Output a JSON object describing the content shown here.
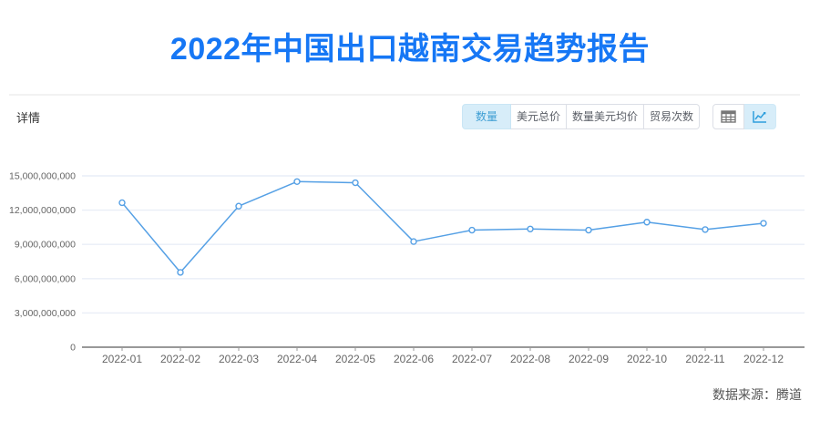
{
  "page": {
    "title": "2022年中国出口越南交易趋势报告",
    "section_label": "详情",
    "source_note": "数据来源：腾道"
  },
  "toolbar": {
    "metric_tabs": [
      {
        "label": "数量",
        "selected": true
      },
      {
        "label": "美元总价",
        "selected": false
      },
      {
        "label": "数量美元均价",
        "selected": false
      },
      {
        "label": "贸易次数",
        "selected": false
      }
    ],
    "view_toggles": [
      {
        "icon": "table-icon",
        "selected": false
      },
      {
        "icon": "line-chart-icon",
        "selected": true
      }
    ]
  },
  "colors": {
    "title_blue": "#1677f5",
    "line_blue": "#55a0e5",
    "selected_bg": "#d7edf9",
    "selected_text": "#3f9fd4",
    "grid_line": "#e9eef7",
    "axis_line": "#999999",
    "tick_label": "#666666"
  },
  "chart_data": {
    "type": "line",
    "title": "",
    "xlabel": "",
    "ylabel": "",
    "x": [
      "2022-01",
      "2022-02",
      "2022-03",
      "2022-04",
      "2022-05",
      "2022-06",
      "2022-07",
      "2022-08",
      "2022-09",
      "2022-10",
      "2022-11",
      "2022-12"
    ],
    "series": [
      {
        "name": "数量",
        "values": [
          12650000000,
          6550000000,
          12350000000,
          14500000000,
          14400000000,
          9250000000,
          10250000000,
          10350000000,
          10250000000,
          10950000000,
          10300000000,
          10850000000
        ]
      }
    ],
    "ylim": [
      0,
      15000000000
    ],
    "yticks": [
      0,
      3000000000,
      6000000000,
      9000000000,
      12000000000,
      15000000000
    ],
    "grid": true,
    "legend": "none",
    "marker": "hollow-circle"
  }
}
